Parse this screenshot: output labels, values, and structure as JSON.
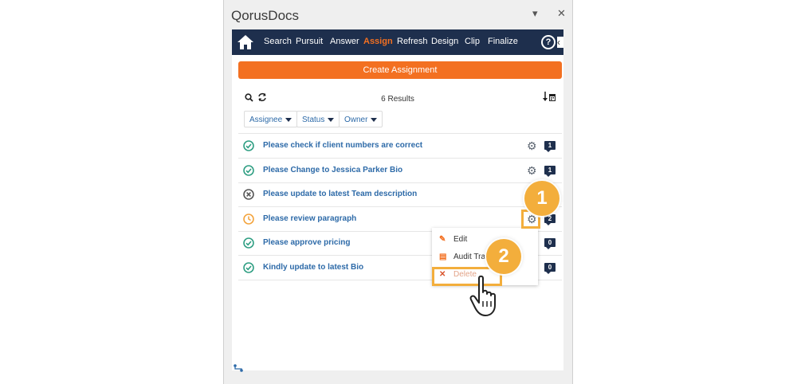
{
  "pane": {
    "title": "QorusDocs",
    "dropdown_glyph": "▾",
    "close_glyph": "✕"
  },
  "nav": {
    "home_icon": "home-icon",
    "items": [
      "Search",
      "Pursuit",
      "Answer",
      "Assign",
      "Refresh",
      "Design",
      "Clip",
      "Finalize"
    ],
    "active": "Assign",
    "help_glyph": "?",
    "collapse_glyph": "‹"
  },
  "create_button": "Create Assignment",
  "toolbar": {
    "results": "6 Results",
    "search_glyph": "🔍",
    "refresh_glyph": "⟳",
    "sort_glyph": "↓▦"
  },
  "filters": [
    "Assignee",
    "Status",
    "Owner"
  ],
  "rows": [
    {
      "label": "Please check if client numbers are correct",
      "status": "complete",
      "badge": "1"
    },
    {
      "label": "Please Change to Jessica Parker Bio",
      "status": "complete",
      "badge": "1"
    },
    {
      "label": "Please update to latest Team description",
      "status": "cancelled",
      "badge": ""
    },
    {
      "label": "Please review paragraph",
      "status": "pending",
      "badge": "2"
    },
    {
      "label": "Please approve pricing",
      "status": "complete",
      "badge": "0"
    },
    {
      "label": "Kindly update to latest Bio",
      "status": "complete",
      "badge": "0"
    }
  ],
  "context_menu": {
    "items": [
      {
        "label": "Edit",
        "icon": "pencil-icon",
        "glyph": "✎"
      },
      {
        "label": "Audit Tra",
        "icon": "document-icon",
        "glyph": "▤"
      },
      {
        "label": "Delete",
        "icon": "x-icon",
        "glyph": "✕"
      }
    ]
  },
  "callouts": [
    "1",
    "2"
  ],
  "colors": {
    "accent": "#f37021",
    "nav": "#1e2f4d",
    "link": "#2d6aa8",
    "complete": "#2e9e82",
    "pending": "#f3a33c",
    "callout": "#f3ae3c"
  }
}
